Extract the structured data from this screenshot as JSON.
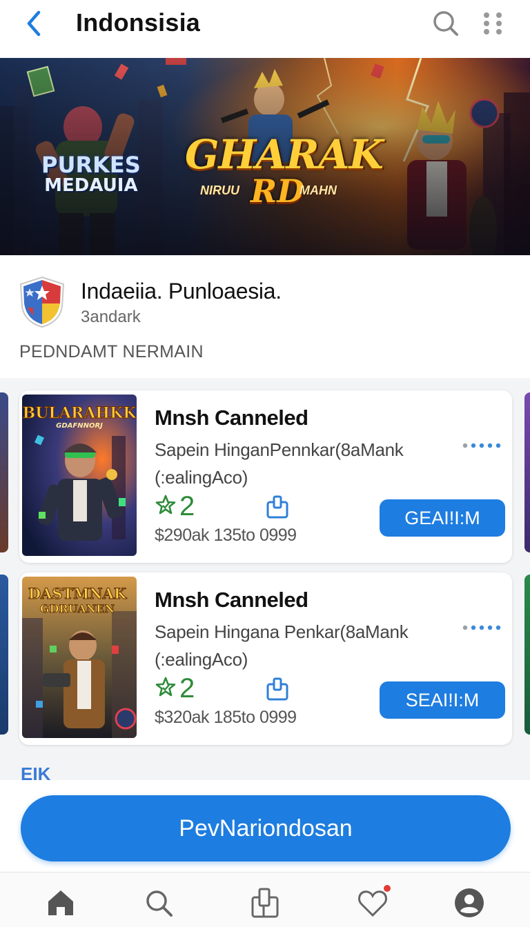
{
  "header": {
    "title": "Indonsisia",
    "back_icon": "chevron-left-icon",
    "search_icon": "search-icon",
    "more_icon": "grid-dots-icon"
  },
  "banner": {
    "left_text_line1": "PURKES",
    "left_text_line2": "MEDAUIA",
    "main_title": "GHARAK",
    "sub_left": "NIRUU",
    "sub_mid": "RD",
    "sub_right": "MAHN"
  },
  "app": {
    "name": "Indaeiia. Punloaesia.",
    "developer": "3andark",
    "section_label": "PEDNDAMT NERMAIN"
  },
  "items": [
    {
      "art_title": "BULARAHKK",
      "art_sub": "GDAFNNORJ",
      "title": "Mnsh Canneled",
      "desc_line1": "Sapein HinganPennkar(8aMank",
      "desc_line2": "(:ealingAco)",
      "rating": "2",
      "price": "$290ak 135to 0999",
      "button": "GEAI!I:M"
    },
    {
      "art_title": "DASTMNAK",
      "art_sub": "GDRUANEN",
      "title": "Mnsh Canneled",
      "desc_line1": "Sapein Hingana Penkar(8aMank",
      "desc_line2": "(:ealingAco)",
      "rating": "2",
      "price": "$320ak 185to 0999",
      "button": "SEAI!I:M"
    }
  ],
  "peek_text": "EIK",
  "cta": {
    "label": "PevNariondosan"
  },
  "bottom_nav": [
    {
      "name": "home",
      "icon": "home-icon"
    },
    {
      "name": "search",
      "icon": "search-icon"
    },
    {
      "name": "library",
      "icon": "library-icon"
    },
    {
      "name": "wishlist",
      "icon": "heart-icon"
    },
    {
      "name": "profile",
      "icon": "profile-icon"
    }
  ],
  "colors": {
    "accent": "#1e7de0",
    "rating_green": "#2e8b3a",
    "badge_red": "#e53935"
  }
}
